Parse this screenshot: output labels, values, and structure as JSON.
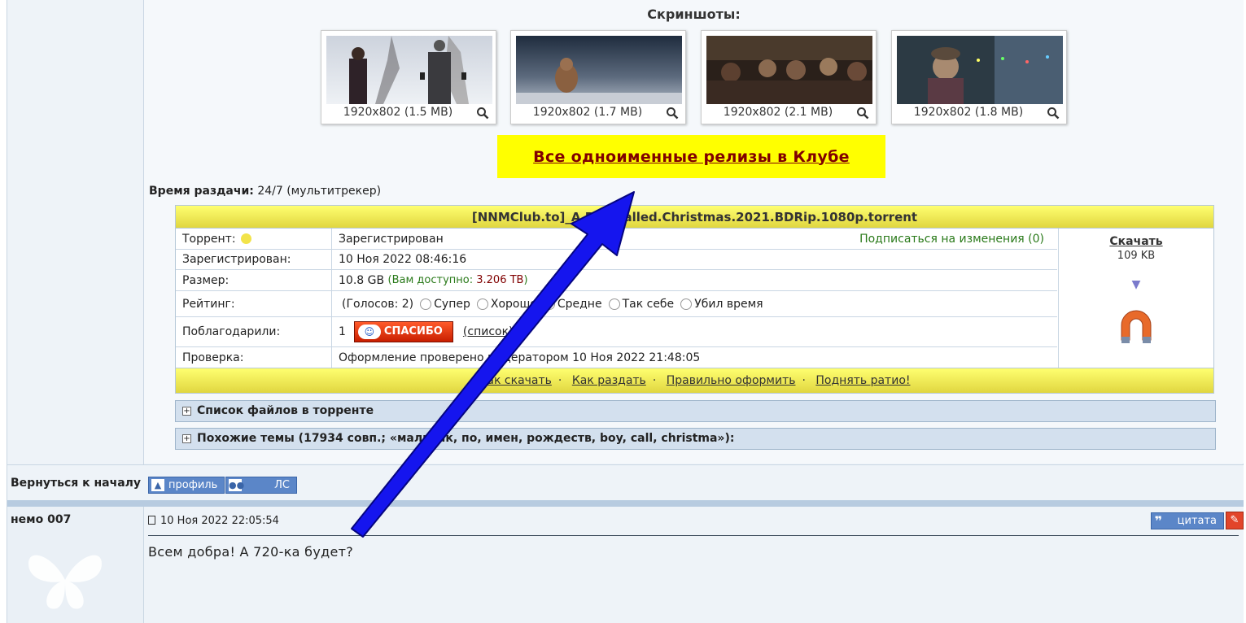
{
  "screenshots": {
    "title": "Скриншоты:",
    "items": [
      {
        "caption": "1920x802 (1.5 MB)"
      },
      {
        "caption": "1920x802 (1.7 MB)"
      },
      {
        "caption": "1920x802 (2.1 MB)"
      },
      {
        "caption": "1920x802 (1.8 MB)"
      }
    ]
  },
  "all_releases_link": "Все одноименные релизы в Клубе",
  "seed_time": {
    "label": "Время раздачи:",
    "value": " 24/7 (мультитрекер)"
  },
  "torrent": {
    "filename": "[NNMClub.to]_A Boy Called.Christmas.2021.BDRip.1080p.torrent",
    "rows": {
      "torrent_label": "Торрент:",
      "torrent_status": "Зарегистрирован",
      "subscribe": "Подписаться на изменения (0)",
      "registered_label": "Зарегистрирован:",
      "registered_value": "10 Ноя 2022 08:46:16",
      "size_label": "Размер:",
      "size_value": "10.8 GB",
      "available_prefix": "(Вам доступно: ",
      "available_value": "3.206 TB",
      "available_suffix": ")",
      "rating_label": "Рейтинг:",
      "votes": "(Голосов: 2)",
      "rating_options": [
        "Супер",
        "Хорошо",
        "Средне",
        "Так себе",
        "Убил время"
      ],
      "thanks_label": "Поблагодарили:",
      "thanks_count": "1",
      "thanks_button": "СПАСИБО",
      "thanks_list": "(список)",
      "check_label": "Проверка:",
      "check_value": "Оформление проверено модератором 10 Ноя 2022 21:48:05"
    },
    "download": {
      "label": "Скачать",
      "size": "109 KB"
    },
    "footer_links": [
      "Как скачать",
      "Как раздать",
      "Правильно оформить",
      "Поднять ратио!"
    ]
  },
  "spoilers": [
    "Список файлов в торренте",
    "Похожие темы (17934 совп.; «мальчик, по, имен, рождеств, boy, call, christma»):"
  ],
  "back_to_top": "Вернуться к началу",
  "profile_buttons": {
    "profile": "профиль",
    "pm": "ЛС"
  },
  "post": {
    "author": "немо 007",
    "date": "10 Ноя 2022 22:05:54",
    "quote_button": "цитата",
    "text": "Всем добра! А 720-ка будет?"
  }
}
